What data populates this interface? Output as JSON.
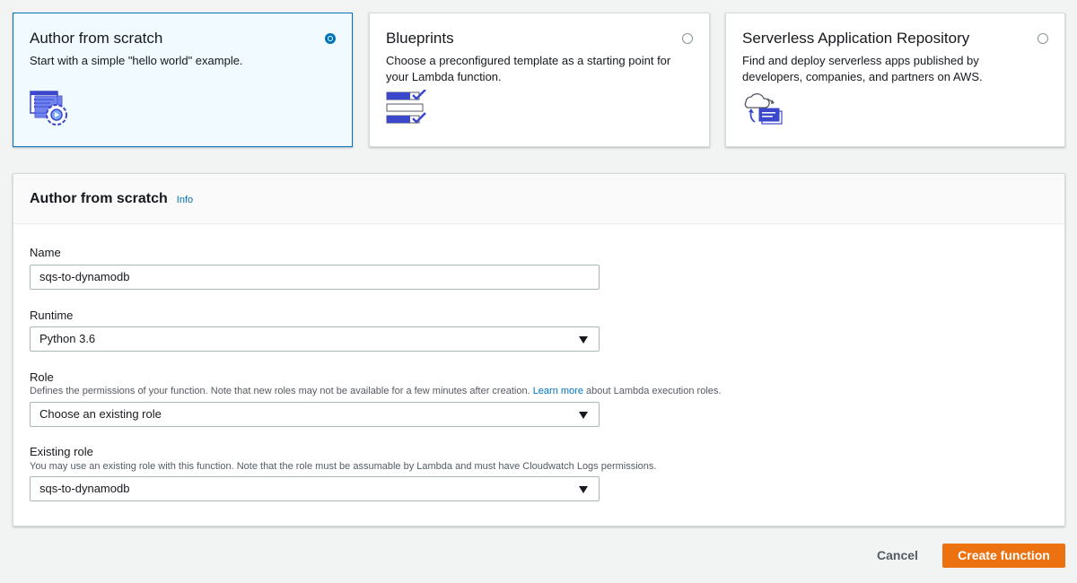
{
  "options": [
    {
      "title": "Author from scratch",
      "description": "Start with a simple \"hello world\" example.",
      "selected": true,
      "icon": "code-gear-icon"
    },
    {
      "title": "Blueprints",
      "description": "Choose a preconfigured template as a starting point for your Lambda function.",
      "selected": false,
      "icon": "checklist-icon"
    },
    {
      "title": "Serverless Application Repository",
      "description": "Find and deploy serverless apps published by developers, companies, and partners on AWS.",
      "selected": false,
      "icon": "cloud-deploy-icon"
    }
  ],
  "panel": {
    "title": "Author from scratch",
    "info": "Info"
  },
  "form": {
    "name_label": "Name",
    "name_value": "sqs-to-dynamodb",
    "runtime_label": "Runtime",
    "runtime_value": "Python 3.6",
    "role_label": "Role",
    "role_desc_pre": "Defines the permissions of your function. Note that new roles may not be available for a few minutes after creation. ",
    "role_desc_link": "Learn more",
    "role_desc_post": " about Lambda execution roles.",
    "role_value": "Choose an existing role",
    "existing_role_label": "Existing role",
    "existing_role_desc": "You may use an existing role with this function. Note that the role must be assumable by Lambda and must have Cloudwatch Logs permissions.",
    "existing_role_value": "sqs-to-dynamodb"
  },
  "actions": {
    "cancel": "Cancel",
    "create": "Create function"
  },
  "colors": {
    "accent": "#0073bb",
    "primary_button": "#ec7211"
  }
}
